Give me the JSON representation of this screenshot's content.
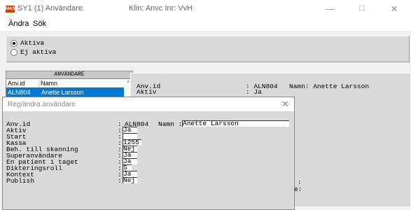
{
  "window": {
    "logo_text": "MAS",
    "title": "SY1 (1) Användare.",
    "client_info": "Klin: Anvc Inr: VvH",
    "controls": {
      "minimize": "—",
      "maximize": "☐",
      "close": "✕"
    }
  },
  "menu": {
    "items": [
      "Ändra",
      "Sök"
    ]
  },
  "filter": {
    "options": [
      {
        "label": "Aktiva",
        "selected": true
      },
      {
        "label": "Ej aktiva",
        "selected": false
      }
    ]
  },
  "user_list": {
    "header": "ANVÄNDARE",
    "columns": [
      "Anv.id",
      "Namn"
    ],
    "rows": [
      {
        "id": "ALN804",
        "name": "Anette Larsson"
      }
    ]
  },
  "detail": {
    "anvid_label": "Anv.id",
    "anvid_value": ": ALN804",
    "namn_text": "Namn: Anette Larsson",
    "aktiv_label": "Aktiv",
    "aktiv_value": ": Ja",
    "partial_colon": ":",
    "partial_suffix": "e:"
  },
  "dialog": {
    "title": "Reg/ändra användare",
    "close": "✕",
    "anvid_label": "Anv.id",
    "anvid_value": "ALN804",
    "namn_label": "Namn :",
    "namn_value": "Anette Larsson",
    "fields": [
      {
        "label": "Aktiv",
        "value": "Ja"
      },
      {
        "label": "Start",
        "value": ""
      },
      {
        "label": "Kassa",
        "value": "1255"
      },
      {
        "label": "Beh. till skanning",
        "value": "Nej"
      },
      {
        "label": "Superanvändare",
        "value": "Ja"
      },
      {
        "label": "En patient i taget",
        "value": "Ja"
      },
      {
        "label": "Dikteringsroll",
        "value": "S"
      },
      {
        "label": "Kontext",
        "value": "Ja"
      },
      {
        "label": "Publish",
        "value": "Nej"
      }
    ]
  }
}
